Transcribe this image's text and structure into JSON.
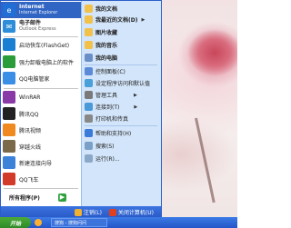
{
  "start_menu": {
    "left": {
      "pinned": [
        {
          "title": "Internet",
          "subtitle": "Internet Explorer",
          "icon": "ie-icon",
          "color": "#1f6fd6"
        },
        {
          "title": "电子邮件",
          "subtitle": "Outlook Express",
          "icon": "outlook-icon",
          "color": "#2e8dd8"
        }
      ],
      "recent": [
        {
          "label": "启动快车(FlashGet)",
          "icon": "flashget-icon",
          "color": "#1a7fd2"
        },
        {
          "label": "强力卸载电脑上的软件",
          "icon": "uninstall-icon",
          "color": "#2b9c3a"
        },
        {
          "label": "QQ电脑管家",
          "icon": "qq-manager-icon",
          "color": "#3a8ee6"
        },
        {
          "label": "WinRAR",
          "icon": "winrar-icon",
          "color": "#8a3aa6"
        },
        {
          "label": "腾讯QQ",
          "icon": "qq-icon",
          "color": "#222222"
        },
        {
          "label": "腾讯视频",
          "icon": "tencent-video-icon",
          "color": "#f08a20"
        },
        {
          "label": "穿越火线",
          "icon": "crossfire-icon",
          "color": "#7a6a4a"
        },
        {
          "label": "新建连接向导",
          "icon": "connection-wizard-icon",
          "color": "#3b82d8"
        },
        {
          "label": "QQ飞车",
          "icon": "qq-speed-icon",
          "color": "#d23a2a"
        }
      ],
      "all_programs": "所有程序(P)"
    },
    "right": {
      "top": [
        {
          "label": "我的文档",
          "icon": "my-documents-icon",
          "color": "#f2c14a"
        },
        {
          "label": "我最近的文档(D)",
          "icon": "recent-documents-icon",
          "color": "#f2c14a"
        },
        {
          "label": "图片收藏",
          "icon": "my-pictures-icon",
          "color": "#f2c14a"
        },
        {
          "label": "我的音乐",
          "icon": "my-music-icon",
          "color": "#f2c14a"
        },
        {
          "label": "我的电脑",
          "icon": "my-computer-icon",
          "color": "#6a8fc8"
        }
      ],
      "middle": [
        {
          "label": "控制面板(C)",
          "icon": "control-panel-icon",
          "color": "#5a8ad8"
        },
        {
          "label": "设定程序访问和默认值",
          "icon": "program-defaults-icon",
          "color": "#4aa0d8"
        },
        {
          "label": "管理工具",
          "icon": "admin-tools-icon",
          "color": "#7a7a7a"
        },
        {
          "label": "连接到(T)",
          "icon": "connect-to-icon",
          "color": "#4a9ad8"
        },
        {
          "label": "打印机和传真",
          "icon": "printers-icon",
          "color": "#888888"
        }
      ],
      "bottom": [
        {
          "label": "帮助和支持(H)",
          "icon": "help-icon",
          "color": "#3a7ad8"
        },
        {
          "label": "搜索(S)",
          "icon": "search-icon",
          "color": "#7aa0c8"
        },
        {
          "label": "运行(R)...",
          "icon": "run-icon",
          "color": "#8aa8c8"
        }
      ]
    },
    "footer": {
      "logoff": "注销(L)",
      "shutdown": "关闭计算机(U)"
    }
  },
  "taskbar": {
    "start_label": "开始",
    "task": "搜狗 - 搜狗问问"
  }
}
